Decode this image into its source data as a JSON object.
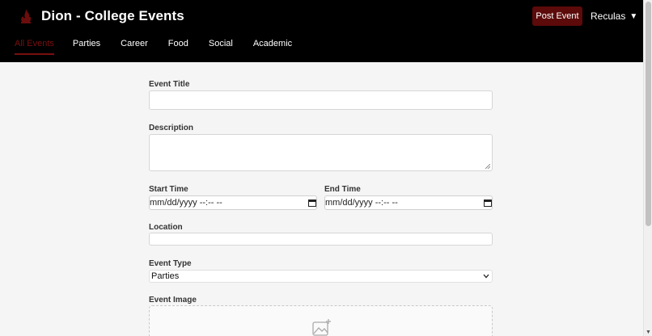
{
  "header": {
    "title": "Dion - College Events",
    "post_button": "Post Event",
    "user_name": "Reculas",
    "user_caret": "▼"
  },
  "nav": {
    "items": [
      "All Events",
      "Parties",
      "Career",
      "Food",
      "Social",
      "Academic"
    ],
    "active_index": 0
  },
  "form": {
    "title_label": "Event Title",
    "title_value": "",
    "description_label": "Description",
    "description_value": "",
    "start_label": "Start Time",
    "start_placeholder": "mm/dd/yyyy --:-- --",
    "end_label": "End Time",
    "end_placeholder": "mm/dd/yyyy --:-- --",
    "location_label": "Location",
    "location_value": "",
    "type_label": "Event Type",
    "type_selected": "Parties",
    "image_label": "Event Image"
  },
  "colors": {
    "accent": "#5c0a0a",
    "active_nav": "#7a0f0f",
    "header_bg": "#000000",
    "page_bg": "#f5f5f5"
  },
  "icons": {
    "brand": "flame-logo-icon",
    "calendar": "calendar-icon",
    "select": "chevron-down-icon",
    "image_upload": "image-add-icon"
  }
}
